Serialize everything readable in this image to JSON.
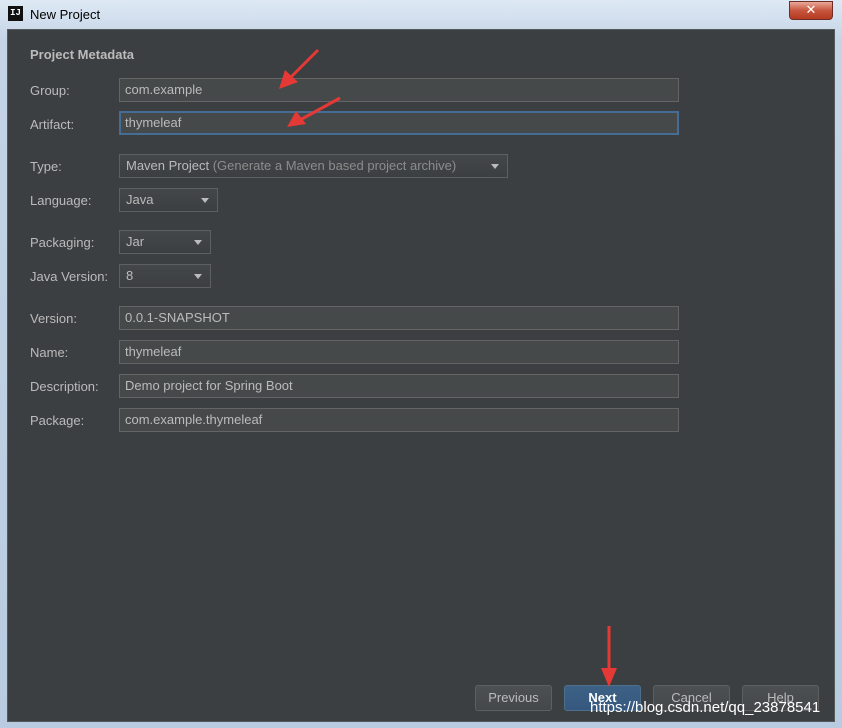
{
  "window": {
    "title": "New Project",
    "close_label": "✕"
  },
  "section_title": "Project Metadata",
  "form": {
    "group": {
      "label": "Group:",
      "value": "com.example"
    },
    "artifact": {
      "label": "Artifact:",
      "value": "thymeleaf"
    },
    "type": {
      "label": "Type:",
      "value": "Maven Project",
      "hint": "(Generate a Maven based project archive)"
    },
    "language": {
      "label": "Language:",
      "value": "Java"
    },
    "packaging": {
      "label": "Packaging:",
      "value": "Jar"
    },
    "java_version": {
      "label": "Java Version:",
      "value": "8"
    },
    "version": {
      "label": "Version:",
      "value": "0.0.1-SNAPSHOT"
    },
    "name": {
      "label": "Name:",
      "value": "thymeleaf"
    },
    "description": {
      "label": "Description:",
      "value": "Demo project for Spring Boot"
    },
    "package": {
      "label": "Package:",
      "value": "com.example.thymeleaf"
    }
  },
  "buttons": {
    "previous": "Previous",
    "next": "Next",
    "cancel": "Cancel",
    "help": "Help"
  },
  "watermark": "https://blog.csdn.net/qq_23878541",
  "colors": {
    "background": "#3c3f41",
    "field": "#45494a",
    "focus": "#466d94",
    "primary_button": "#365880",
    "annotation_arrow": "#e53935"
  }
}
